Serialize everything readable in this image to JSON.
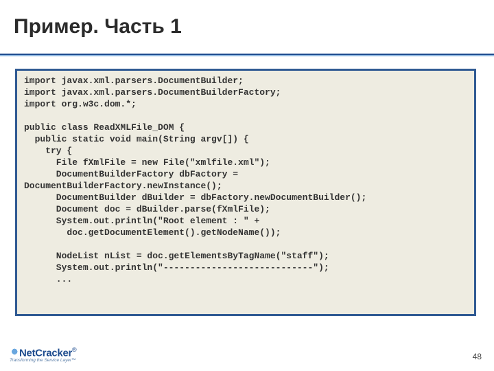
{
  "title": "Пример. Часть 1",
  "pagenum": "48",
  "logo": {
    "brand": "NetCracker",
    "tag": "Transforming the Service Layer"
  },
  "code": "import javax.xml.parsers.DocumentBuilder;\nimport javax.xml.parsers.DocumentBuilderFactory;\nimport org.w3c.dom.*;\n\npublic class ReadXMLFile_DOM {\n  public static void main(String argv[]) {\n    try {\n      File fXmlFile = new File(\"xmlfile.xml\");\n      DocumentBuilderFactory dbFactory =\nDocumentBuilderFactory.newInstance();\n      DocumentBuilder dBuilder = dbFactory.newDocumentBuilder();\n      Document doc = dBuilder.parse(fXmlFile);\n      System.out.println(\"Root element : \" +\n        doc.getDocumentElement().getNodeName());\n\n      NodeList nList = doc.getElementsByTagName(\"staff\");\n      System.out.println(\"----------------------------\");\n      ..."
}
